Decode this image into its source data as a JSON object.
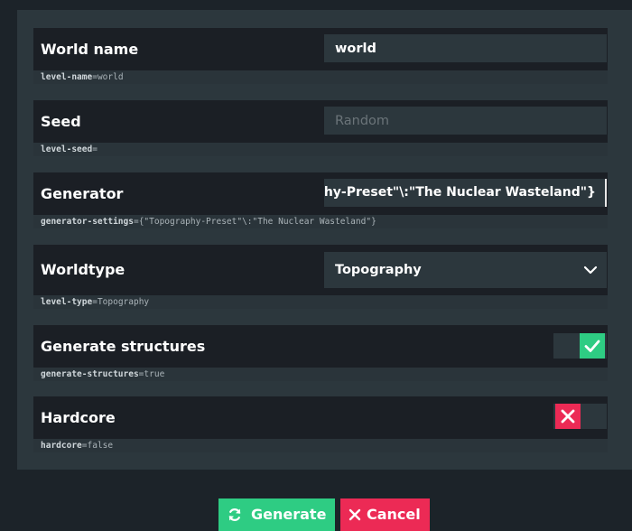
{
  "colors": {
    "background": "#1c2329",
    "panel": "#2c373d",
    "row": "#1b1f25",
    "accent_green": "#2ecc83",
    "accent_red": "#ec2a55"
  },
  "settings": [
    {
      "label": "World name",
      "control": "text",
      "value": "world",
      "placeholder": "",
      "key": "level-name",
      "prop_value": "world"
    },
    {
      "label": "Seed",
      "control": "text",
      "value": "",
      "placeholder": "Random",
      "key": "level-seed",
      "prop_value": ""
    },
    {
      "label": "Generator",
      "control": "text",
      "value": "{\"Topography-Preset\"\\:\"The Nuclear Wasteland\"}",
      "visible_value": "hy-Preset\"\\:\"The Nuclear Wasteland\"}",
      "key": "generator-settings",
      "prop_value": "{\"Topography-Preset\"\\:\"The Nuclear Wasteland\"}"
    },
    {
      "label": "Worldtype",
      "control": "select",
      "value": "Topography",
      "icon": "chevron-down-icon",
      "key": "level-type",
      "prop_value": "Topography"
    },
    {
      "label": "Generate structures",
      "control": "toggle",
      "checked": true,
      "icon": "check-icon",
      "key": "generate-structures",
      "prop_value": "true"
    },
    {
      "label": "Hardcore",
      "control": "toggle",
      "checked": false,
      "icon": "x-icon",
      "key": "hardcore",
      "prop_value": "false"
    }
  ],
  "buttons": {
    "generate_label": "Generate",
    "generate_icon": "refresh-icon",
    "cancel_label": "Cancel",
    "cancel_icon": "x-icon"
  }
}
